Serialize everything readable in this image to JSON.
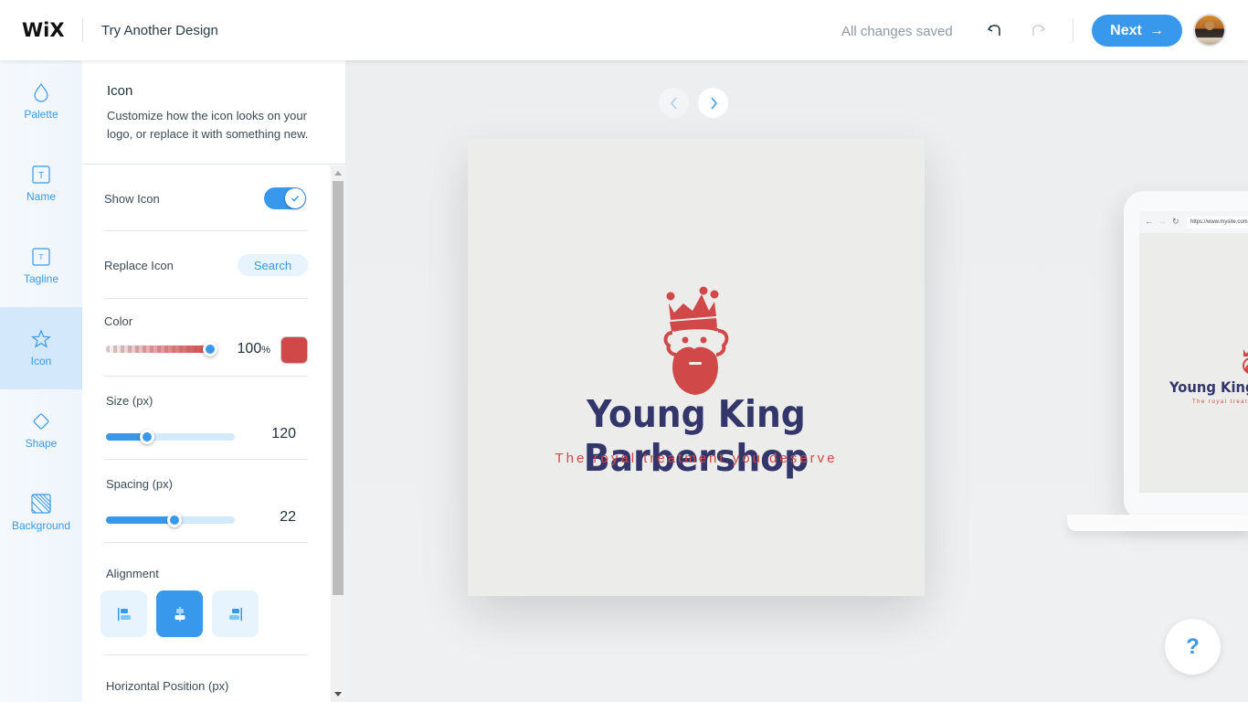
{
  "header": {
    "logo": "WiX",
    "title": "Try Another Design",
    "status": "All changes saved",
    "next_label": "Next",
    "next_arrow": "→"
  },
  "rail": {
    "items": [
      {
        "label": "Palette",
        "icon": "droplet-icon"
      },
      {
        "label": "Name",
        "icon": "text-box-icon"
      },
      {
        "label": "Tagline",
        "icon": "text-box-small-icon"
      },
      {
        "label": "Icon",
        "icon": "star-icon",
        "active": true
      },
      {
        "label": "Shape",
        "icon": "diamond-icon"
      },
      {
        "label": "Background",
        "icon": "hatched-square-icon"
      }
    ]
  },
  "panel": {
    "title": "Icon",
    "description": "Customize how the icon looks on your logo, or replace it with something new.",
    "show_icon": {
      "label": "Show Icon",
      "on": true
    },
    "replace_icon": {
      "label": "Replace Icon",
      "button": "Search"
    },
    "color": {
      "label": "Color",
      "opacity_value": "100",
      "opacity_unit": "%",
      "opacity_fraction": 1.0,
      "swatch": "#d04848"
    },
    "size": {
      "label": "Size (px)",
      "value": "120",
      "fraction": 0.32
    },
    "spacing": {
      "label": "Spacing (px)",
      "value": "22",
      "fraction": 0.53
    },
    "alignment": {
      "label": "Alignment",
      "options": [
        "left",
        "center",
        "right"
      ],
      "selected": "center"
    },
    "horizontal_position": {
      "label": "Horizontal Position (px)"
    }
  },
  "canvas": {
    "brand_name": "Young King Barbershop",
    "tagline": "The royal treatment you deserve",
    "brand_color": "#34356a",
    "accent_color": "#d04848",
    "preview_url": "https://www.mysite.com",
    "mini_name": "Young King",
    "mini_tagline": "The royal treat"
  },
  "help": {
    "label": "?"
  }
}
